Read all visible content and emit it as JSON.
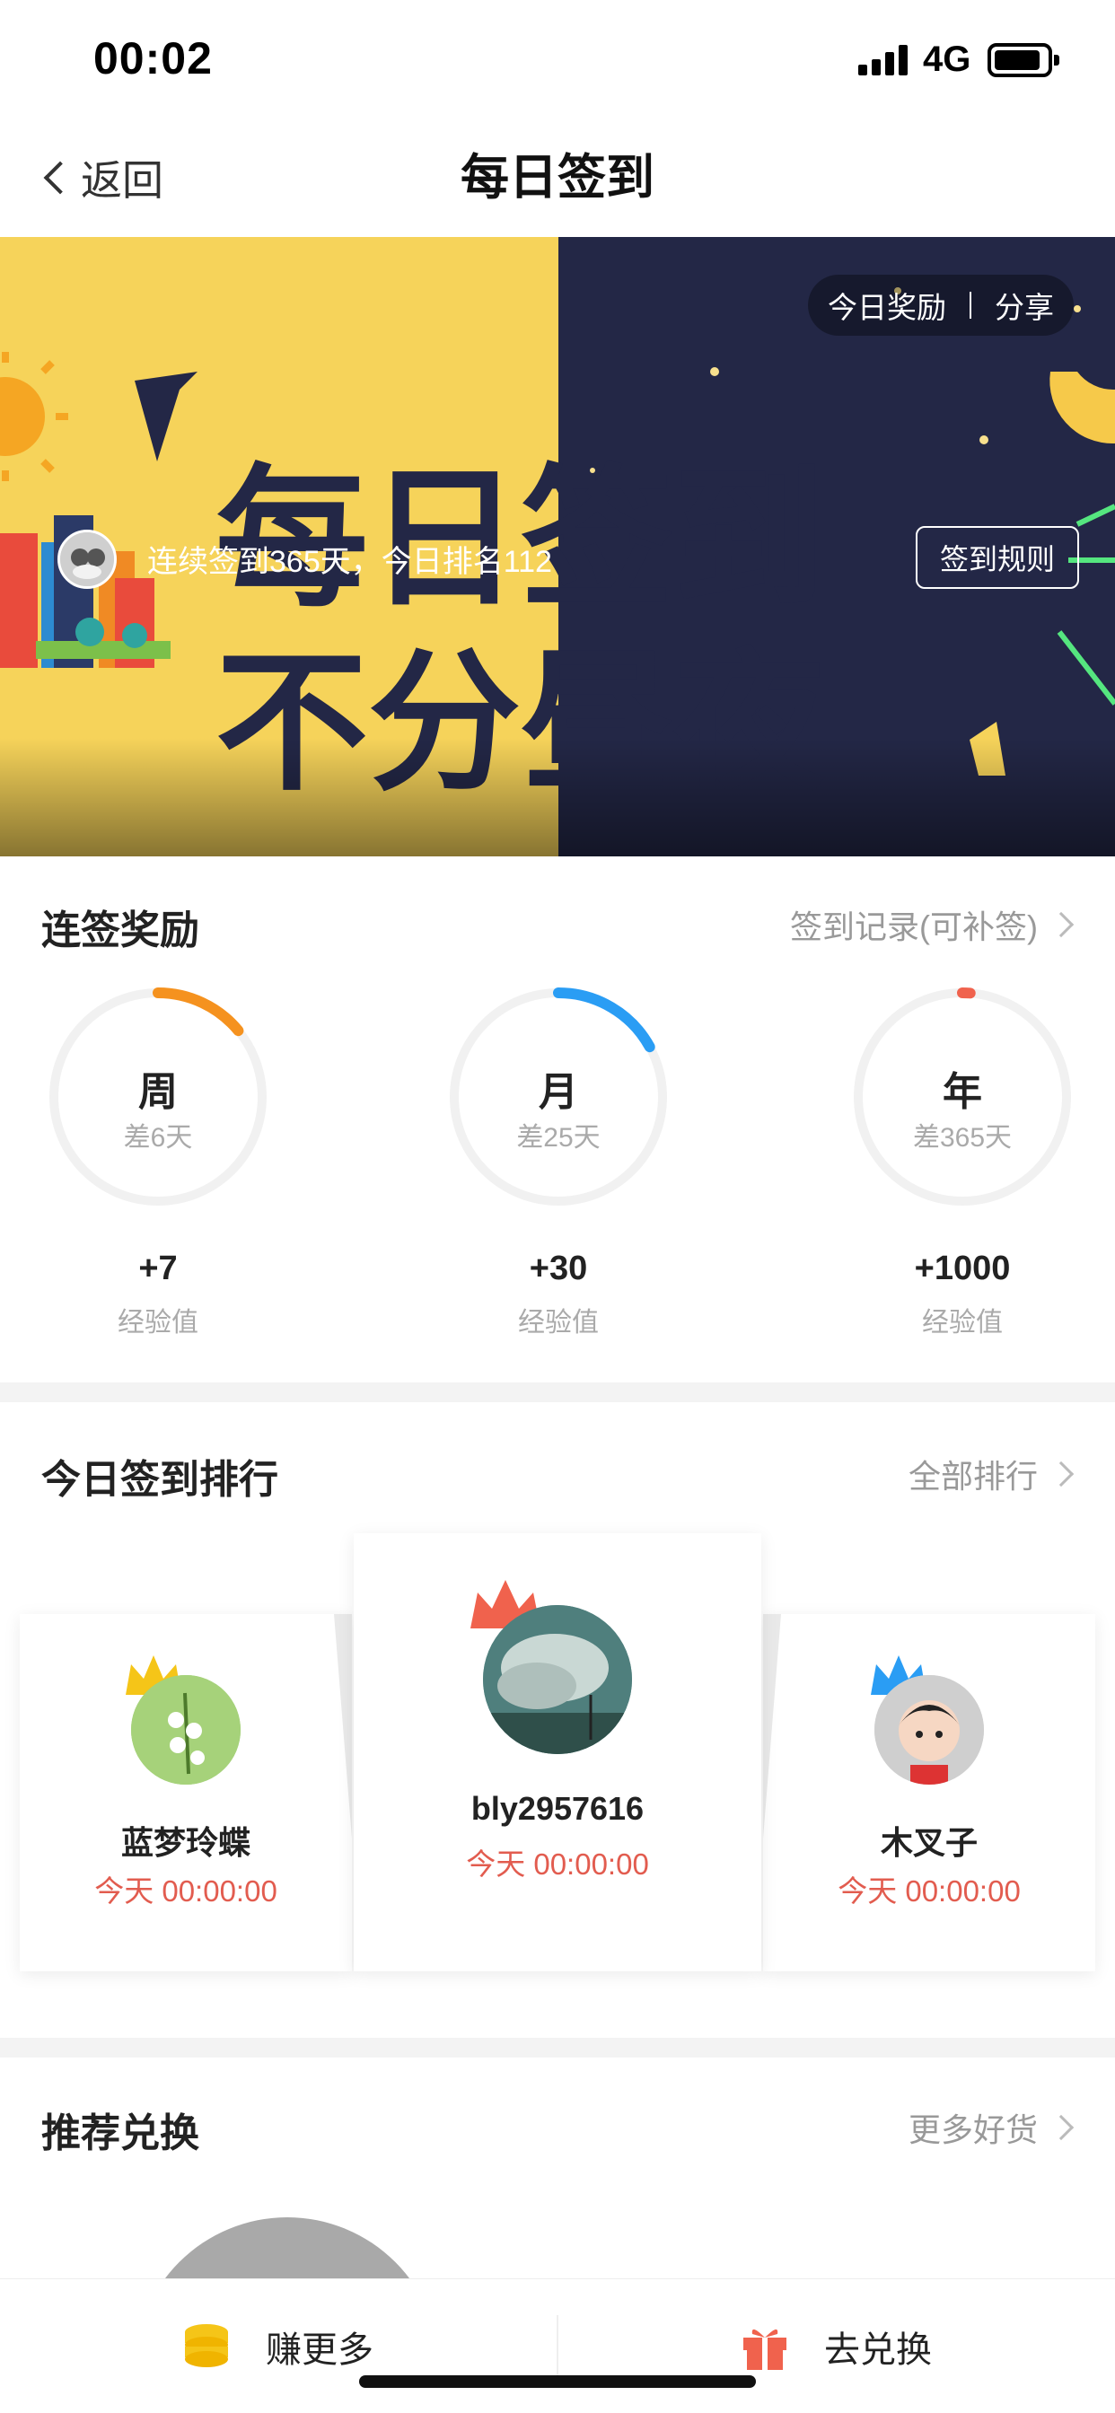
{
  "status_bar": {
    "time": "00:02",
    "network": "4G"
  },
  "nav": {
    "back_label": "返回",
    "title": "每日签到"
  },
  "banner": {
    "title_line1": "每日签到",
    "title_line2": "不分昼夜",
    "today_reward": "今日奖励",
    "share": "分享",
    "streak_text": "连续签到365天，今日排名112",
    "rules_button": "签到规则"
  },
  "streak_rewards": {
    "title": "连签奖励",
    "link": "签到记录(可补签)",
    "items": [
      {
        "name": "周",
        "remaining": "差6天",
        "reward": "+7",
        "unit": "经验值",
        "progress": 0.14,
        "color": "#f5921f"
      },
      {
        "name": "月",
        "remaining": "差25天",
        "reward": "+30",
        "unit": "经验值",
        "progress": 0.17,
        "color": "#2a9df4"
      },
      {
        "name": "年",
        "remaining": "差365天",
        "reward": "+1000",
        "unit": "经验值",
        "progress": 0.0,
        "color": "#f0624d"
      }
    ]
  },
  "ranking": {
    "title": "今日签到排行",
    "link": "全部排行",
    "entries": [
      {
        "name": "蓝梦玲蝶",
        "time": "今天 00:00:00",
        "crown_color": "#f5c518"
      },
      {
        "name": "bly2957616",
        "time": "今天 00:00:00",
        "crown_color": "#f0624d"
      },
      {
        "name": "木叉子",
        "time": "今天 00:00:00",
        "crown_color": "#2a9df4"
      }
    ]
  },
  "exchange": {
    "title": "推荐兑换",
    "link": "更多好货"
  },
  "bottom_bar": {
    "earn_label": "赚更多",
    "exchange_label": "去兑换"
  }
}
